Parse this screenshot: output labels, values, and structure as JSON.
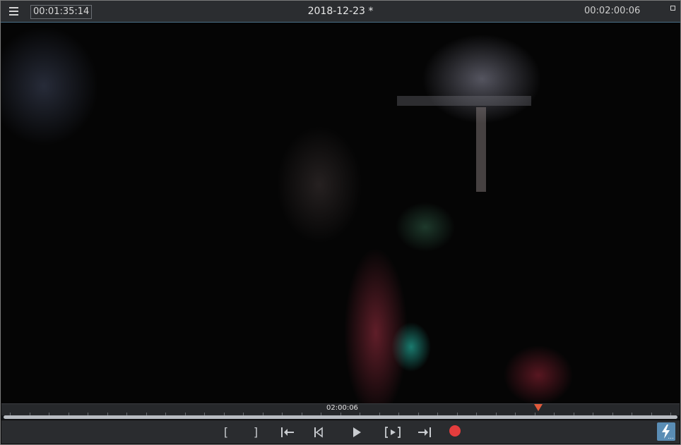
{
  "topbar": {
    "current_timecode": "00:01:35:14",
    "title": "2018-12-23 *",
    "duration_timecode": "00:02:00:06"
  },
  "timeline": {
    "ruler_label": "02:00:06"
  },
  "transport": {
    "mark_in_label": "[",
    "mark_out_label": "]"
  },
  "icons": {
    "menu": "hamburger-icon",
    "expand": "expand-icon",
    "go_to_in": "go-to-in-icon",
    "previous_frame": "previous-frame-icon",
    "play": "play-icon",
    "play_in_out": "play-in-out-icon",
    "go_to_out": "go-to-out-icon",
    "record": "record-icon",
    "quick_actions": "lightning-icon"
  },
  "colors": {
    "accent": "#5a8db5",
    "marker": "#e2593a",
    "record": "#e43d3d"
  }
}
